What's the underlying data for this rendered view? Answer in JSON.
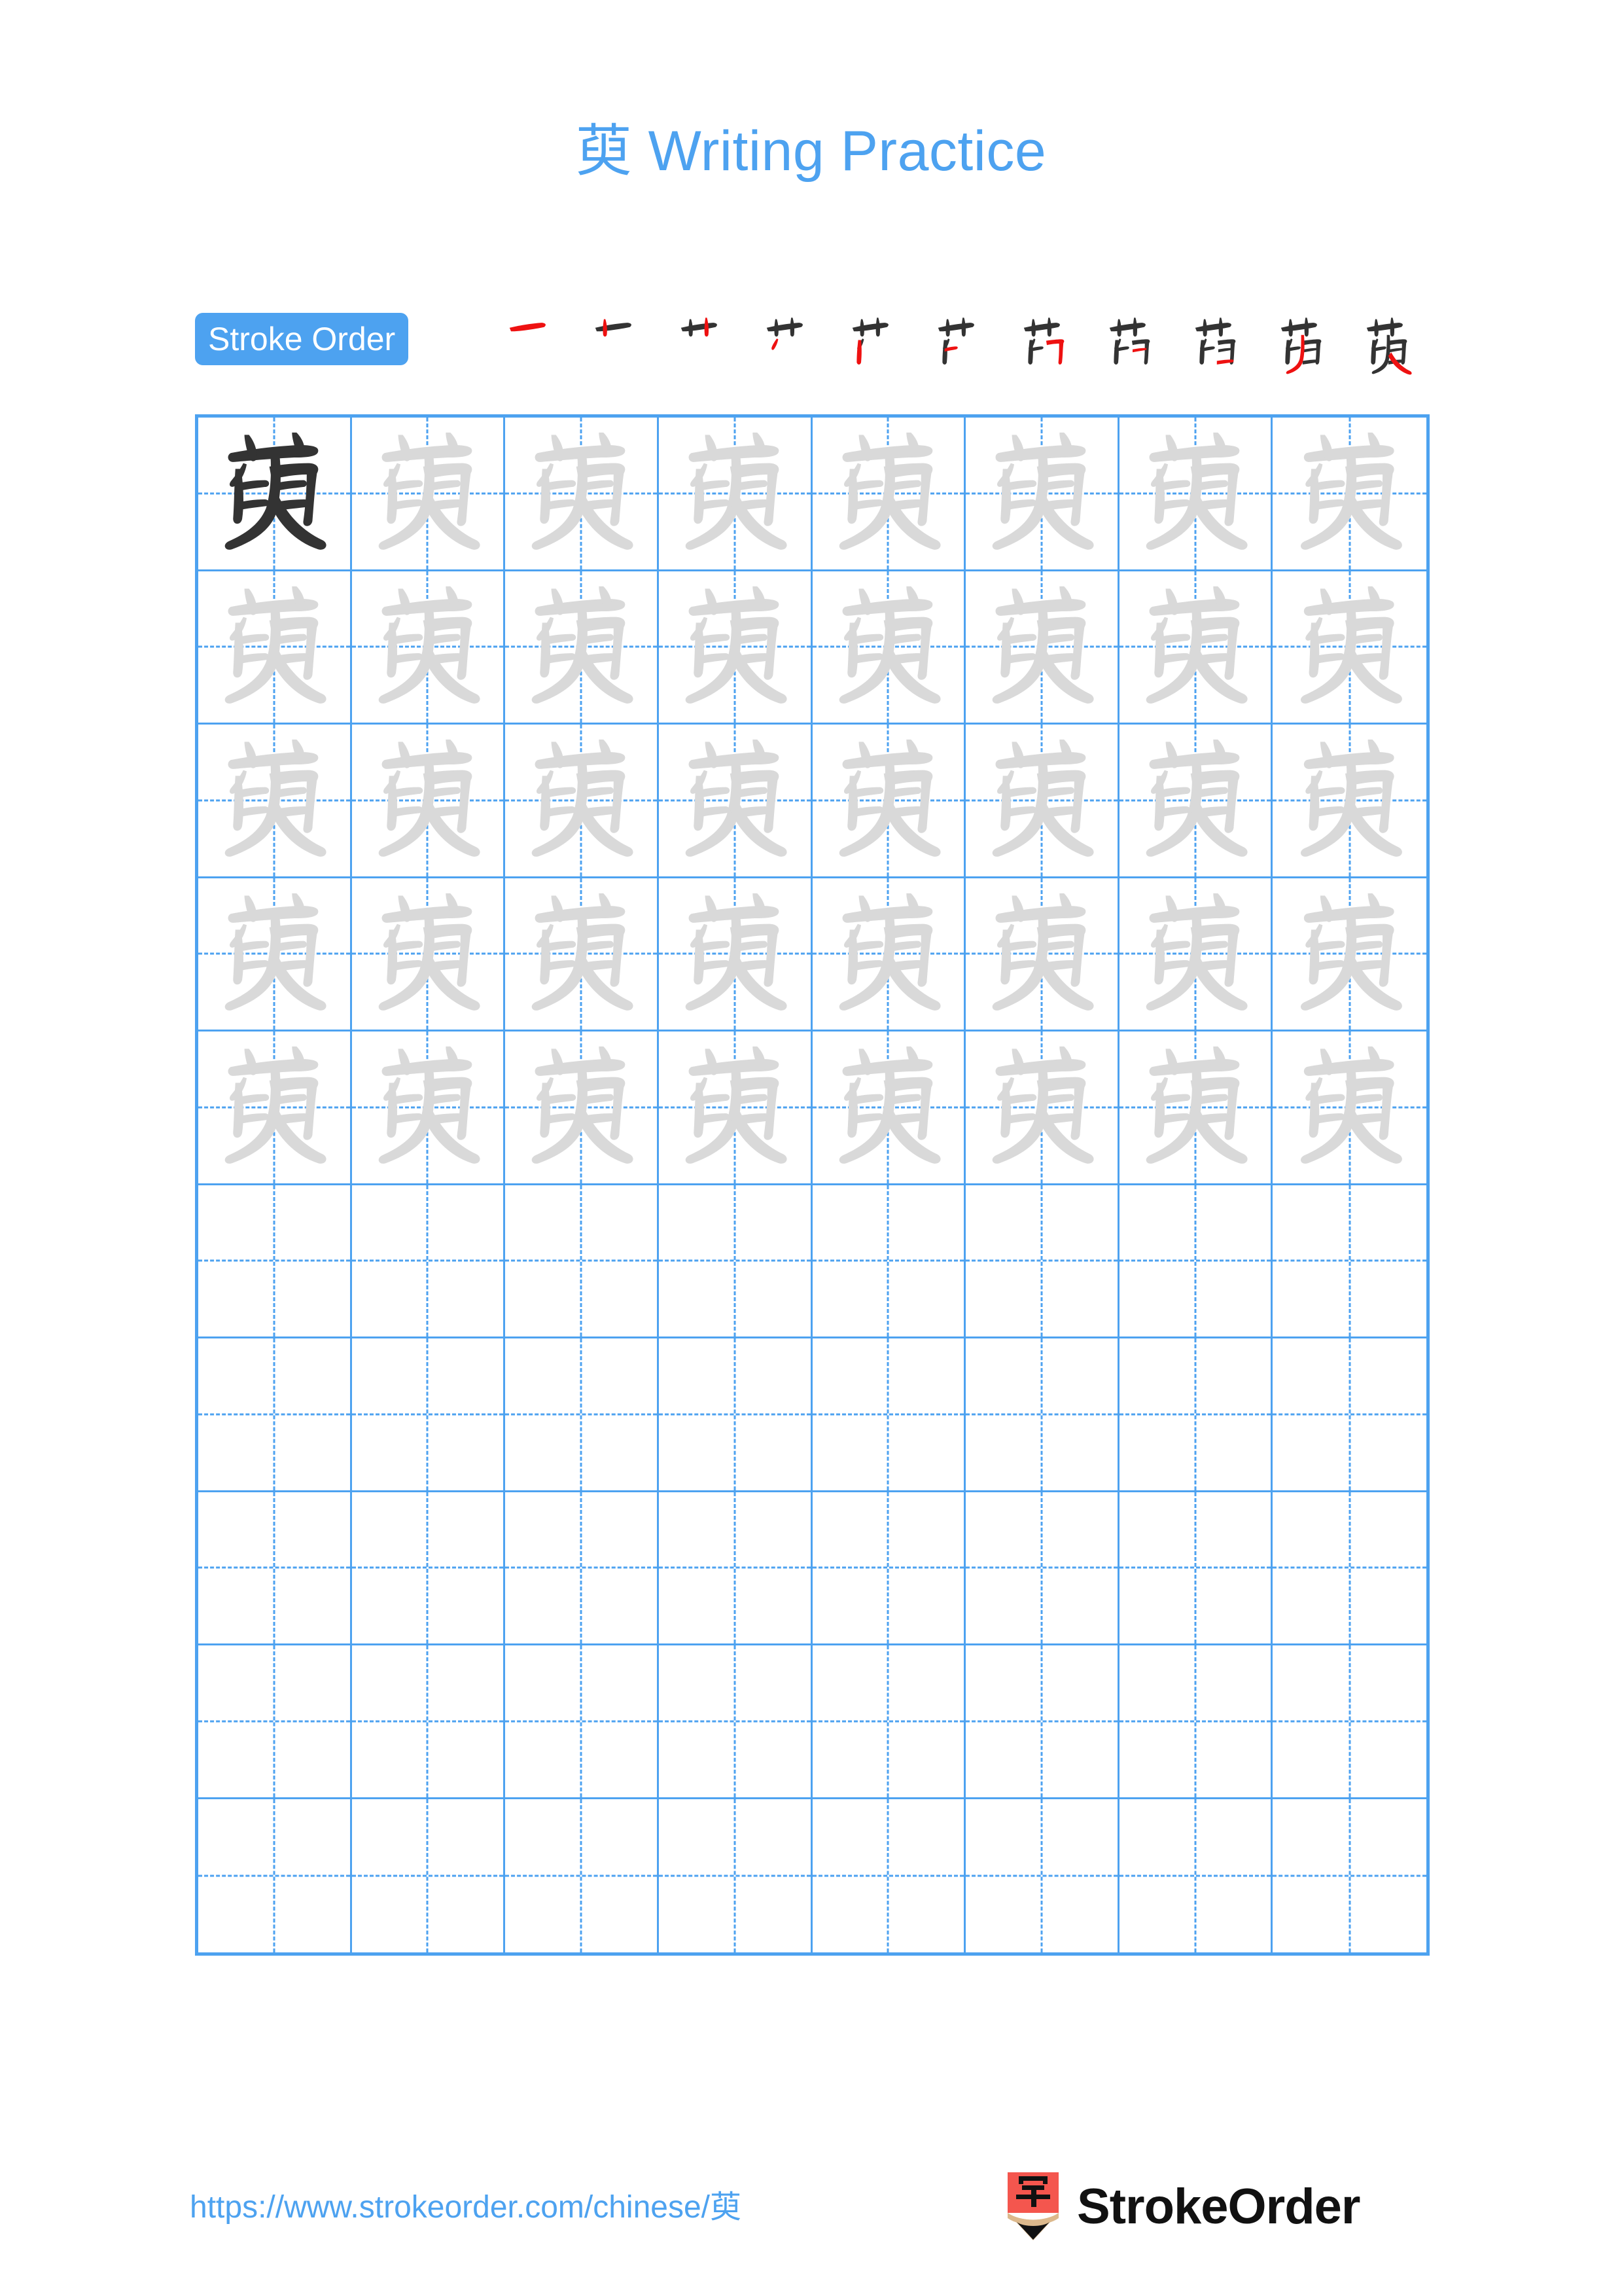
{
  "page": {
    "character": "萸",
    "title": "萸 Writing Practice",
    "background_color": "#ffffff",
    "accent_color": "#4da2f0",
    "stroke_highlight_color": "#ee1111",
    "traced_char_color": "#d9d9d9",
    "model_char_color": "#333333"
  },
  "stroke_order": {
    "badge_label": "Stroke Order",
    "total_strokes": 11,
    "steps": [
      {
        "index": 1,
        "label": "一",
        "new_stroke": "heng"
      },
      {
        "index": 2,
        "label": "𠃊",
        "new_stroke": "shu"
      },
      {
        "index": 3,
        "label": "艹",
        "new_stroke": "shu"
      },
      {
        "index": 4,
        "label": "艹",
        "new_stroke": "pie"
      },
      {
        "index": 5,
        "label": "芢",
        "new_stroke": "shu"
      },
      {
        "index": 6,
        "label": "芢",
        "new_stroke": "heng"
      },
      {
        "index": 7,
        "label": "苉",
        "new_stroke": "heng-zhe"
      },
      {
        "index": 8,
        "label": "苉",
        "new_stroke": "heng"
      },
      {
        "index": 9,
        "label": "茁",
        "new_stroke": "heng"
      },
      {
        "index": 10,
        "label": "萸",
        "new_stroke": "pie"
      },
      {
        "index": 11,
        "label": "萸",
        "new_stroke": "na"
      }
    ]
  },
  "practice_grid": {
    "columns": 8,
    "rows": 10,
    "filled_rows": 5,
    "empty_rows": 5,
    "model_cell_index": 0,
    "cell_character": "萸"
  },
  "footer": {
    "url": "https://www.strokeorder.com/chinese/萸",
    "logo_character": "字",
    "logo_text": "StrokeOrder",
    "logo_body_color": "#f4564e",
    "logo_wood_color": "#ddb98c",
    "logo_tip_color": "#111111"
  }
}
